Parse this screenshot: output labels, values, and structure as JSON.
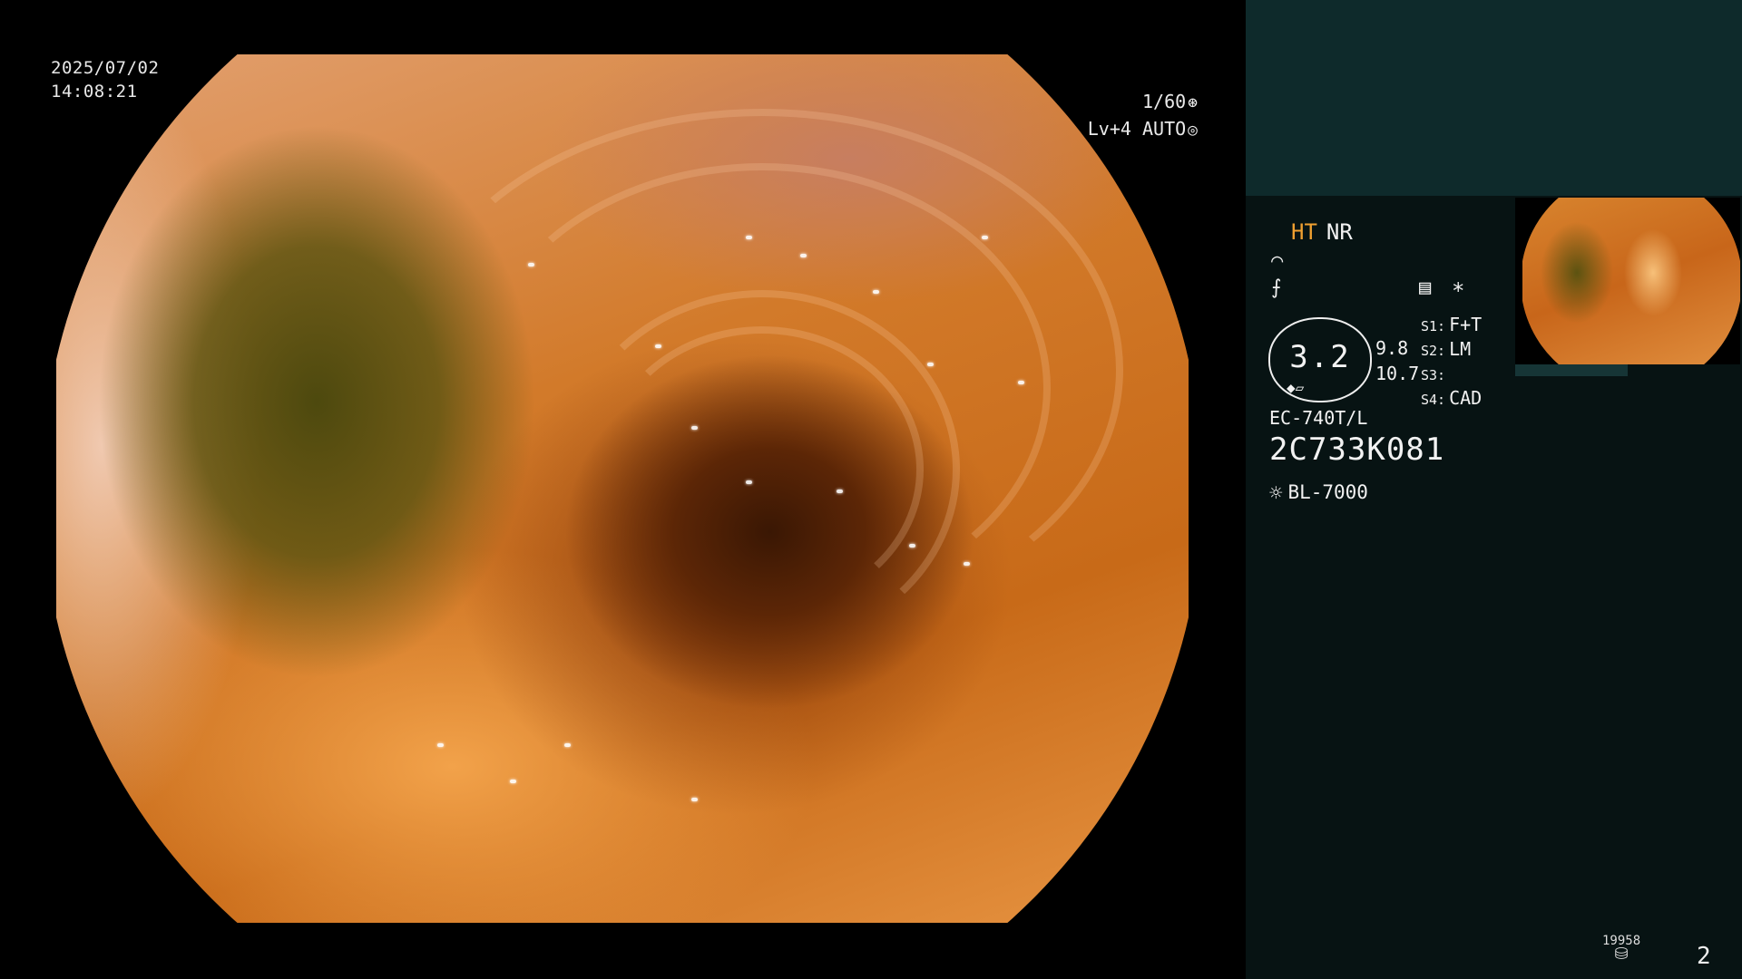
{
  "overlay": {
    "date": "2025/07/02",
    "time": "14:08:21",
    "shutter": "1/60",
    "shutter_icon": "aperture-icon",
    "level": "Lv+4",
    "mode": "AUTO",
    "mode_icon": "auto-exposure-icon"
  },
  "panel": {
    "ht": "HT",
    "nr": "NR",
    "enhance_icon": "⌒",
    "freeze_icon": "⨍",
    "menu_icon": "▤",
    "star": "*",
    "gauge": {
      "value": "3.2",
      "right_top": "9.8",
      "right_bottom": "10.7"
    },
    "settings": [
      {
        "key": "S1:",
        "value": "F+T"
      },
      {
        "key": "S2:",
        "value": "LM"
      },
      {
        "key": "S3:",
        "value": ""
      },
      {
        "key": "S4:",
        "value": "CAD"
      }
    ],
    "scope_model": "EC-740T/L",
    "scope_serial": "2C733K081",
    "light_source": "BL-7000",
    "storage_count": "19958",
    "page": "2"
  },
  "colors": {
    "ht_accent": "#f0a030",
    "panel_top": "#0e2a2b",
    "panel_bg": "#071313"
  }
}
